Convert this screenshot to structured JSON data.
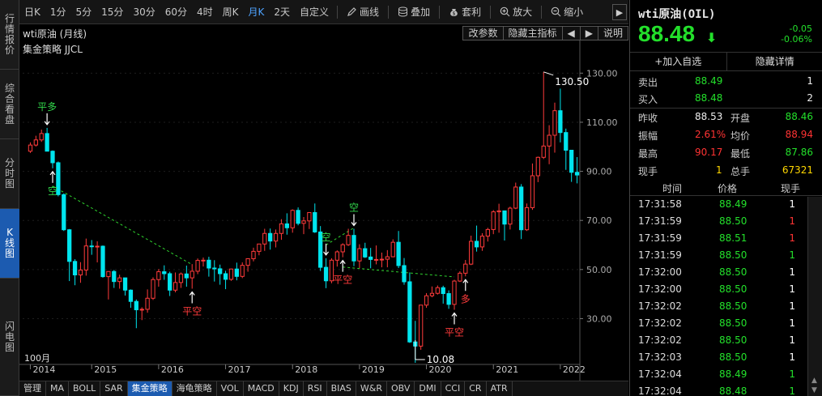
{
  "left_tabs": [
    {
      "label": "行情报价",
      "active": false
    },
    {
      "label": "综合看盘",
      "active": false
    },
    {
      "label": "分时图",
      "active": false
    },
    {
      "label": "K线图",
      "active": true
    },
    {
      "label": "闪电图",
      "active": false
    }
  ],
  "toolbar": {
    "periods": [
      {
        "label": "日K",
        "active": false
      },
      {
        "label": "1分",
        "active": false
      },
      {
        "label": "5分",
        "active": false
      },
      {
        "label": "15分",
        "active": false
      },
      {
        "label": "30分",
        "active": false
      },
      {
        "label": "60分",
        "active": false
      },
      {
        "label": "4时",
        "active": false
      },
      {
        "label": "周K",
        "active": false
      },
      {
        "label": "月K",
        "active": true
      },
      {
        "label": "2天",
        "active": false
      },
      {
        "label": "自定义",
        "active": false
      }
    ],
    "draw_label": "画线",
    "overlay_label": "叠加",
    "profit_label": "套利",
    "zoom_in_label": "放大",
    "zoom_out_label": "缩小",
    "next_label": "▶"
  },
  "chart_header": {
    "title": "wti原油 (月线)",
    "strategy": "集金策略 JJCL",
    "buttons": [
      "改参数",
      "隐藏主指标",
      "◀",
      "▶",
      "说明"
    ]
  },
  "chart_data": {
    "type": "candlestick",
    "period_label": "100月",
    "x_ticks": [
      "2014",
      "2015",
      "2016",
      "2017",
      "2018",
      "2019",
      "2020",
      "2021",
      "2022"
    ],
    "y_ticks": [
      30.0,
      50.0,
      70.0,
      90.0,
      110.0,
      130.0
    ],
    "ylim": [
      12,
      140
    ],
    "high_label": "130.50",
    "low_label": "10.08",
    "up_color": "#ff3b3b",
    "down_color": "#00e5ee",
    "signal_up_color": "#32d74b",
    "signal_down_color": "#ff3b3b",
    "signals": [
      {
        "text": "平多",
        "index": 3,
        "color": "green",
        "arrow": "down"
      },
      {
        "text": "空",
        "index": 4,
        "color": "green",
        "arrow": "up"
      },
      {
        "text": "平空",
        "index": 29,
        "color": "red",
        "arrow": "up"
      },
      {
        "text": "空",
        "index": 53,
        "color": "green",
        "arrow": "down"
      },
      {
        "text": "平空",
        "index": 56,
        "color": "red",
        "arrow": "up"
      },
      {
        "text": "空",
        "index": 58,
        "color": "green",
        "arrow": "down"
      },
      {
        "text": "平空",
        "index": 76,
        "color": "red",
        "arrow": "up"
      },
      {
        "text": "多",
        "index": 78,
        "color": "red",
        "arrow": "up"
      }
    ],
    "candles": [
      [
        98.2,
        101.8,
        97.5,
        100.7
      ],
      [
        100.7,
        104.5,
        100.1,
        102.8
      ],
      [
        102.8,
        107.0,
        102.0,
        105.4
      ],
      [
        105.4,
        107.7,
        98.5,
        98.2
      ],
      [
        98.2,
        98.5,
        91.2,
        93.5
      ],
      [
        93.5,
        94.0,
        79.8,
        80.5
      ],
      [
        80.5,
        81.0,
        65.7,
        66.2
      ],
      [
        66.2,
        66.5,
        45.3,
        53.3
      ],
      [
        53.3,
        54.2,
        43.6,
        47.8
      ],
      [
        47.8,
        53.0,
        44.6,
        49.8
      ],
      [
        49.8,
        62.6,
        47.5,
        59.6
      ],
      [
        59.6,
        62.0,
        56.0,
        59.5
      ],
      [
        59.5,
        61.5,
        52.9,
        59.5
      ],
      [
        59.5,
        59.8,
        46.7,
        47.1
      ],
      [
        47.1,
        49.3,
        37.8,
        49.2
      ],
      [
        49.2,
        49.8,
        42.5,
        45.1
      ],
      [
        45.1,
        47.9,
        42.2,
        46.6
      ],
      [
        46.6,
        46.7,
        39.4,
        41.6
      ],
      [
        41.6,
        41.9,
        34.4,
        37.0
      ],
      [
        37.0,
        37.8,
        26.1,
        33.6
      ],
      [
        33.6,
        34.6,
        29.4,
        33.8
      ],
      [
        33.8,
        41.9,
        32.4,
        38.3
      ],
      [
        38.3,
        46.8,
        37.6,
        45.9
      ],
      [
        45.9,
        50.2,
        43.0,
        49.1
      ],
      [
        49.1,
        51.7,
        45.8,
        48.3
      ],
      [
        48.3,
        49.1,
        39.2,
        41.6
      ],
      [
        41.6,
        48.8,
        40.7,
        44.7
      ],
      [
        44.7,
        48.8,
        42.5,
        48.2
      ],
      [
        48.2,
        51.6,
        43.0,
        46.6
      ],
      [
        46.6,
        52.2,
        42.2,
        49.3
      ],
      [
        49.3,
        54.5,
        48.1,
        53.7
      ],
      [
        53.7,
        54.9,
        51.2,
        53.8
      ],
      [
        53.8,
        55.2,
        47.1,
        50.6
      ],
      [
        50.6,
        53.8,
        45.1,
        50.3
      ],
      [
        50.3,
        52.0,
        43.8,
        48.3
      ],
      [
        48.3,
        49.5,
        42.0,
        46.0
      ],
      [
        46.0,
        50.4,
        45.4,
        50.2
      ],
      [
        50.2,
        52.8,
        45.6,
        47.2
      ],
      [
        47.2,
        52.9,
        46.5,
        51.7
      ],
      [
        51.7,
        54.6,
        49.1,
        54.4
      ],
      [
        54.4,
        58.9,
        53.3,
        57.4
      ],
      [
        57.4,
        60.5,
        55.8,
        60.4
      ],
      [
        60.4,
        66.6,
        57.6,
        64.7
      ],
      [
        64.7,
        66.7,
        58.1,
        61.6
      ],
      [
        61.6,
        66.3,
        59.0,
        64.7
      ],
      [
        64.7,
        70.5,
        62.1,
        68.6
      ],
      [
        68.6,
        72.9,
        64.2,
        67.0
      ],
      [
        67.0,
        74.5,
        65.0,
        74.1
      ],
      [
        74.1,
        75.3,
        68.0,
        68.8
      ],
      [
        68.8,
        71.4,
        64.4,
        69.8
      ],
      [
        69.8,
        73.1,
        66.5,
        73.2
      ],
      [
        73.2,
        76.9,
        64.9,
        65.3
      ],
      [
        65.3,
        67.7,
        49.4,
        50.9
      ],
      [
        50.9,
        54.6,
        42.4,
        45.4
      ],
      [
        45.4,
        54.6,
        44.4,
        53.8
      ],
      [
        53.8,
        57.8,
        51.2,
        57.2
      ],
      [
        57.2,
        60.7,
        55.0,
        60.1
      ],
      [
        60.1,
        66.6,
        59.6,
        63.9
      ],
      [
        63.9,
        66.6,
        51.4,
        53.5
      ],
      [
        53.5,
        60.3,
        50.6,
        58.5
      ],
      [
        58.5,
        60.9,
        54.7,
        55.1
      ],
      [
        55.1,
        58.8,
        50.5,
        54.1
      ],
      [
        54.1,
        59.8,
        52.1,
        54.1
      ],
      [
        54.1,
        56.9,
        50.9,
        54.2
      ],
      [
        54.2,
        57.9,
        50.9,
        55.2
      ],
      [
        55.2,
        62.3,
        55.0,
        61.1
      ],
      [
        61.1,
        65.7,
        50.6,
        51.6
      ],
      [
        51.6,
        54.7,
        43.8,
        45.0
      ],
      [
        45.0,
        48.8,
        20.1,
        20.5
      ],
      [
        20.5,
        29.1,
        6.5,
        18.8
      ],
      [
        18.8,
        35.2,
        17.3,
        35.5
      ],
      [
        35.5,
        40.4,
        34.4,
        39.3
      ],
      [
        39.3,
        43.1,
        38.7,
        40.3
      ],
      [
        40.3,
        43.5,
        39.8,
        42.6
      ],
      [
        42.6,
        43.4,
        36.1,
        40.2
      ],
      [
        40.2,
        41.5,
        34.0,
        35.8
      ],
      [
        35.8,
        45.8,
        33.6,
        45.3
      ],
      [
        45.3,
        49.3,
        44.9,
        48.5
      ],
      [
        48.5,
        53.9,
        47.2,
        52.2
      ],
      [
        52.2,
        63.8,
        51.8,
        61.5
      ],
      [
        61.5,
        67.9,
        57.3,
        59.2
      ],
      [
        59.2,
        64.8,
        57.6,
        63.6
      ],
      [
        63.6,
        67.0,
        61.4,
        66.3
      ],
      [
        66.3,
        74.2,
        64.4,
        73.5
      ],
      [
        73.5,
        76.8,
        65.0,
        73.9
      ],
      [
        73.9,
        74.0,
        61.8,
        68.5
      ],
      [
        68.5,
        75.6,
        66.3,
        75.0
      ],
      [
        75.0,
        85.4,
        74.6,
        83.6
      ],
      [
        83.6,
        84.8,
        62.4,
        66.2
      ],
      [
        66.2,
        76.9,
        65.7,
        75.2
      ],
      [
        75.2,
        93.2,
        74.3,
        88.2
      ],
      [
        88.2,
        96.0,
        85.6,
        95.7
      ],
      [
        95.7,
        130.5,
        95.0,
        100.3
      ],
      [
        100.3,
        108.8,
        92.9,
        104.7
      ],
      [
        104.7,
        118.0,
        97.6,
        114.7
      ],
      [
        114.7,
        123.7,
        101.8,
        105.8
      ],
      [
        105.8,
        107.4,
        90.6,
        98.6
      ],
      [
        98.6,
        97.8,
        85.7,
        89.6
      ],
      [
        89.6,
        95.8,
        85.1,
        88.5
      ]
    ]
  },
  "indicators": [
    {
      "label": "管理",
      "active": false
    },
    {
      "label": "MA",
      "active": false
    },
    {
      "label": "BOLL",
      "active": false
    },
    {
      "label": "SAR",
      "active": false
    },
    {
      "label": "集金策略",
      "active": true
    },
    {
      "label": "海龟策略",
      "active": false
    },
    {
      "label": "VOL",
      "active": false
    },
    {
      "label": "MACD",
      "active": false
    },
    {
      "label": "KDJ",
      "active": false
    },
    {
      "label": "RSI",
      "active": false
    },
    {
      "label": "BIAS",
      "active": false
    },
    {
      "label": "W&R",
      "active": false
    },
    {
      "label": "OBV",
      "active": false
    },
    {
      "label": "DMI",
      "active": false
    },
    {
      "label": "CCI",
      "active": false
    },
    {
      "label": "CR",
      "active": false
    },
    {
      "label": "ATR",
      "active": false
    }
  ],
  "quote": {
    "name": "wti原油(OIL)",
    "price": "88.48",
    "arrow": "⬇",
    "change": "-0.05",
    "change_pct": "-0.06%",
    "add_watch": "+加入自选",
    "hide_detail": "隐藏详情",
    "sell_label": "卖出",
    "sell_price": "88.49",
    "sell_vol": "1",
    "buy_label": "买入",
    "buy_price": "88.48",
    "buy_vol": "2",
    "prev_close_label": "昨收",
    "prev_close": "88.53",
    "open_label": "开盘",
    "open": "88.46",
    "amplitude_label": "振幅",
    "amplitude": "2.61%",
    "avg_label": "均价",
    "avg": "88.94",
    "high_label": "最高",
    "high": "90.17",
    "low_label": "最低",
    "low": "87.86",
    "cur_vol_label": "现手",
    "cur_vol": "1",
    "total_vol_label": "总手",
    "total_vol": "67321"
  },
  "ticks_header": {
    "time": "时间",
    "price": "价格",
    "vol": "现手"
  },
  "ticks": [
    {
      "time": "17:31:58",
      "price": "88.49",
      "vol": "1",
      "vol_color": "#ffffff"
    },
    {
      "time": "17:31:59",
      "price": "88.50",
      "vol": "1",
      "vol_color": "#ff3333"
    },
    {
      "time": "17:31:59",
      "price": "88.51",
      "vol": "1",
      "vol_color": "#ff3333"
    },
    {
      "time": "17:31:59",
      "price": "88.50",
      "vol": "1",
      "vol_color": "#23e02b"
    },
    {
      "time": "17:32:00",
      "price": "88.50",
      "vol": "1",
      "vol_color": "#ffffff"
    },
    {
      "time": "17:32:00",
      "price": "88.50",
      "vol": "1",
      "vol_color": "#ffffff"
    },
    {
      "time": "17:32:02",
      "price": "88.50",
      "vol": "1",
      "vol_color": "#ffffff"
    },
    {
      "time": "17:32:02",
      "price": "88.50",
      "vol": "1",
      "vol_color": "#ffffff"
    },
    {
      "time": "17:32:02",
      "price": "88.50",
      "vol": "1",
      "vol_color": "#ffffff"
    },
    {
      "time": "17:32:03",
      "price": "88.50",
      "vol": "1",
      "vol_color": "#ffffff"
    },
    {
      "time": "17:32:04",
      "price": "88.49",
      "vol": "1",
      "vol_color": "#23e02b"
    },
    {
      "time": "17:32:04",
      "price": "88.48",
      "vol": "1",
      "vol_color": "#23e02b"
    }
  ]
}
